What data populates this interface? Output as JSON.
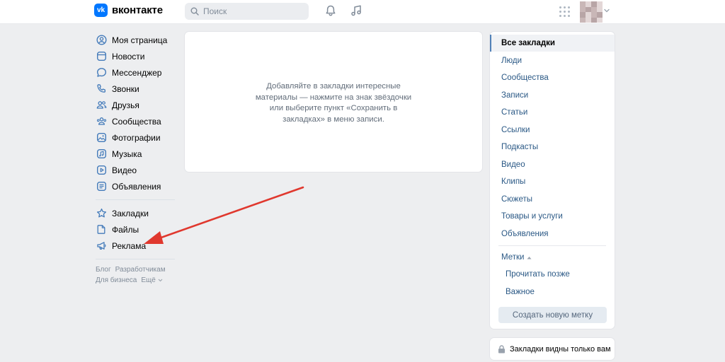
{
  "header": {
    "logo_mark": "vk",
    "logo_text": "вконтакте",
    "search_placeholder": "Поиск",
    "icons": [
      "search-icon",
      "bell-icon",
      "music-icon",
      "apps-icon",
      "chevron-down-icon"
    ]
  },
  "leftnav": {
    "main": [
      {
        "label": "Моя страница",
        "icon": "user-icon"
      },
      {
        "label": "Новости",
        "icon": "news-icon"
      },
      {
        "label": "Мессенджер",
        "icon": "message-icon"
      },
      {
        "label": "Звонки",
        "icon": "phone-icon"
      },
      {
        "label": "Друзья",
        "icon": "friends-icon"
      },
      {
        "label": "Сообщества",
        "icon": "communities-icon"
      },
      {
        "label": "Фотографии",
        "icon": "photo-icon"
      },
      {
        "label": "Музыка",
        "icon": "music-icon"
      },
      {
        "label": "Видео",
        "icon": "video-icon"
      },
      {
        "label": "Объявления",
        "icon": "ads-icon"
      }
    ],
    "secondary": [
      {
        "label": "Закладки",
        "icon": "star-icon"
      },
      {
        "label": "Файлы",
        "icon": "file-icon"
      },
      {
        "label": "Реклама",
        "icon": "megaphone-icon"
      }
    ],
    "footer": {
      "blog": "Блог",
      "developers": "Разработчикам",
      "business": "Для бизнеса",
      "more": "Ещё"
    }
  },
  "main": {
    "empty_text": "Добавляйте в закладки интересные материалы — нажмите на знак звёздочки или выберите пункт «Сохранить в закладках» в меню записи."
  },
  "rightmenu": {
    "items": [
      {
        "label": "Все закладки",
        "active": true
      },
      {
        "label": "Люди"
      },
      {
        "label": "Сообщества"
      },
      {
        "label": "Записи"
      },
      {
        "label": "Статьи"
      },
      {
        "label": "Ссылки"
      },
      {
        "label": "Подкасты"
      },
      {
        "label": "Видео"
      },
      {
        "label": "Клипы"
      },
      {
        "label": "Сюжеты"
      },
      {
        "label": "Товары и услуги"
      },
      {
        "label": "Объявления"
      }
    ],
    "tags_title": "Метки",
    "tags": [
      "Прочитать позже",
      "Важное"
    ],
    "create_tag_button": "Создать новую метку",
    "privacy_note": "Закладки видны только вам"
  },
  "colors": {
    "background": "#edeef0",
    "link": "#2a5885",
    "accent": "#0077ff",
    "arrow": "#e0382e"
  }
}
